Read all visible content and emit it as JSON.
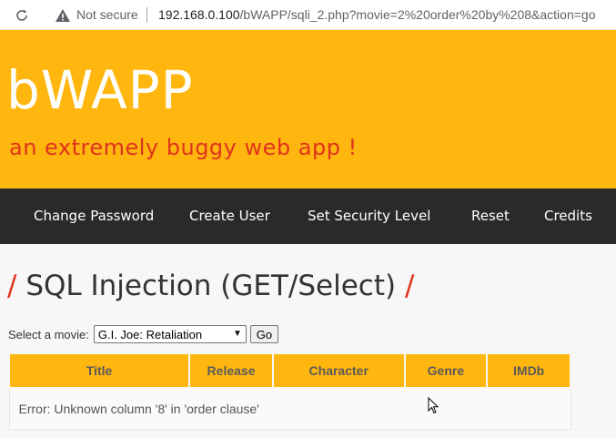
{
  "browser": {
    "security_label": "Not secure",
    "url_host": "192.168.0.100",
    "url_path": "/bWAPP/sqli_2.php?movie=2%20order%20by%208&action=go",
    "icons": [
      "reload-icon",
      "warning-icon"
    ]
  },
  "header": {
    "logo": "bWAPP",
    "tagline": "an extremely buggy web app !",
    "background_color": "#ffb70f",
    "tagline_color": "#e0331c"
  },
  "nav": {
    "items": [
      {
        "label": "Change Password"
      },
      {
        "label": "Create User"
      },
      {
        "label": "Set Security Level"
      },
      {
        "label": "Reset"
      },
      {
        "label": "Credits"
      }
    ],
    "background_color": "#2a2a2a"
  },
  "page": {
    "title_slash_left": "/",
    "title": "SQL Injection (GET/Select)",
    "title_slash_right": "/",
    "select_label": "Select a movie:",
    "selected_movie": "G.I. Joe: Retaliation",
    "go_label": "Go"
  },
  "table": {
    "headers": [
      "Title",
      "Release",
      "Character",
      "Genre",
      "IMDb"
    ],
    "error_message": "Error: Unknown column '8' in 'order clause'"
  }
}
